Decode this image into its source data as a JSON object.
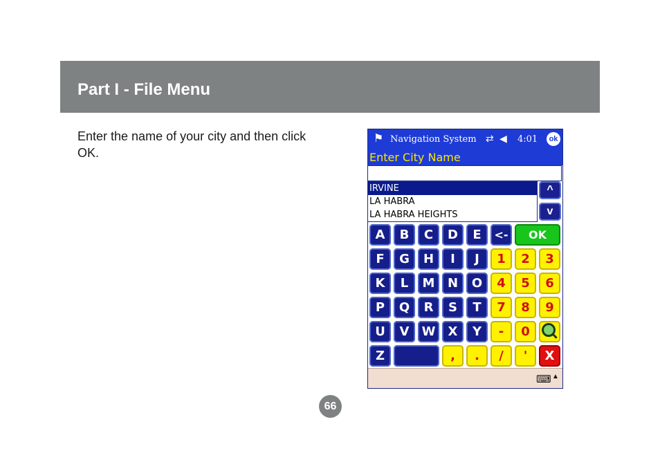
{
  "header": {
    "title": "Part I - File Menu"
  },
  "body": {
    "instruction": "Enter the name of your city and then click OK."
  },
  "device": {
    "titlebar": {
      "logo_icon": "windows-flag-icon",
      "app_title": "Navigation System",
      "connectivity_icon": "connectivity-icon",
      "connectivity_glyph": "⇄",
      "volume_icon": "speaker-icon",
      "volume_glyph": "◀",
      "clock": "4:01",
      "ok_label": "ok"
    },
    "prompt": "Enter City Name",
    "city_input_value": "",
    "city_list": [
      "IRVINE",
      "LA HABRA",
      "LA HABRA HEIGHTS"
    ],
    "selected_index": 0,
    "scroll_up": "^",
    "scroll_down": "v",
    "keyboard_rows": [
      [
        "A",
        "B",
        "C",
        "D",
        "E",
        "<-",
        "OK"
      ],
      [
        "F",
        "G",
        "H",
        "I",
        "J",
        "1",
        "2",
        "3"
      ],
      [
        "K",
        "L",
        "M",
        "N",
        "O",
        "4",
        "5",
        "6"
      ],
      [
        "P",
        "Q",
        "R",
        "S",
        "T",
        "7",
        "8",
        "9"
      ],
      [
        "U",
        "V",
        "W",
        "X",
        "Y",
        "-",
        "0",
        "search"
      ],
      [
        "Z",
        "space",
        ",",
        ".",
        "/",
        "'",
        "X"
      ]
    ],
    "status_bar": {
      "keyboard_icon": "keyboard-icon",
      "keyboard_glyph": "⌨",
      "sip_arrow": "▲"
    }
  },
  "page_number": "66",
  "colors": {
    "header_bg": "#7e8283",
    "pda_blue": "#1e3bd6",
    "key_blue": "#151e8a",
    "key_yellow": "#fff200",
    "key_green": "#17c51b",
    "key_red": "#e01010",
    "prompt_text": "#ffe600"
  }
}
